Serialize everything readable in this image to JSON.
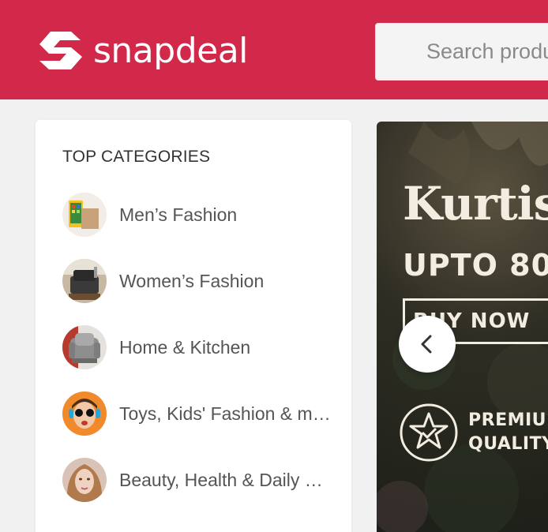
{
  "header": {
    "logo_text": "snapdeal",
    "brand_color": "#d2294b",
    "search_placeholder": "Search products & brands"
  },
  "sidebar": {
    "title": "TOP CATEGORIES",
    "items": [
      {
        "label": "Men’s Fashion",
        "icon": "mens-fashion-thumb"
      },
      {
        "label": "Women’s Fashion",
        "icon": "womens-fashion-thumb"
      },
      {
        "label": "Home & Kitchen",
        "icon": "home-kitchen-thumb"
      },
      {
        "label": "Toys, Kids' Fashion & more",
        "icon": "toys-kids-thumb"
      },
      {
        "label": "Beauty, Health & Daily Needs",
        "icon": "beauty-health-thumb"
      }
    ]
  },
  "banner": {
    "title": "Kurtis",
    "subtitle": "UPTO 80",
    "cta": "BUY NOW",
    "badge": [
      "PREMIUM",
      "QUALITY"
    ]
  },
  "carousel": {
    "prev_icon": "chevron-left-icon"
  }
}
